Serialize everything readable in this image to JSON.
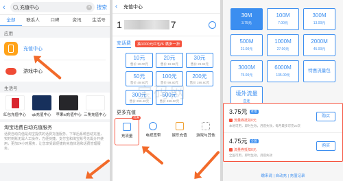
{
  "panel1": {
    "search_text": "充值中心",
    "clear_glyph": "×",
    "search_button": "搜索",
    "tabs": [
      {
        "label": "全部",
        "active": true
      },
      {
        "label": "联系人",
        "active": false
      },
      {
        "label": "口碑",
        "active": false
      },
      {
        "label": "资讯",
        "active": false
      },
      {
        "label": "生活号",
        "active": false
      }
    ],
    "apps_section": "应用",
    "apps": [
      {
        "name": "充值中心",
        "icon": "phone-icon"
      },
      {
        "name": "游戏中心",
        "icon": "gamepad-icon"
      }
    ],
    "life_section": "生活号",
    "life_items": [
      {
        "name": "红包充值中心"
      },
      {
        "name": "qb充值中心"
      },
      {
        "name": "苹果id充值中心"
      },
      {
        "name": "三角充值中心"
      }
    ],
    "article_title": "淘宝话费自动充值服务",
    "article_body": "话费自动充值是淘宝提供的话费充值服务，下单后系统自动充值，实时到账无需人工操作，方便快捷。支付宝和淘宝账号无需分开使用，更加24小时服务，让您享受最便捷的充值体验和话费管理服务。"
  },
  "panel2": {
    "title": "充值中心",
    "phone_prefix": "1",
    "phone_suffix": "7",
    "tab_label": "充话费",
    "promo": "抽1000元红包/6 满多一折",
    "amounts": [
      {
        "value": "10元",
        "sub": "售价 10.00元"
      },
      {
        "value": "20元",
        "sub": "售价 19.96元"
      },
      {
        "value": "30元",
        "sub": "售价 29.94元"
      },
      {
        "value": "50元",
        "sub": "售价 49.90元"
      },
      {
        "value": "100元",
        "sub": "售价 99.80元"
      },
      {
        "value": "200元",
        "sub": "售价 199.60元"
      },
      {
        "value": "300元",
        "sub": "售价 299.40元"
      },
      {
        "value": "500元",
        "sub": "售价 499.00元"
      }
    ],
    "more_title": "更多充值",
    "more_items": [
      {
        "name": "充流量",
        "icon": "flow-icon",
        "badge": "优惠"
      },
      {
        "name": "电视宽带",
        "icon": "tv-icon"
      },
      {
        "name": "娱乐充值",
        "icon": "video-icon"
      },
      {
        "name": "游戏与其他",
        "icon": "grid-icon"
      }
    ],
    "watermark": "宝码网"
  },
  "panel3": {
    "flows": [
      {
        "value": "30M",
        "sub": "3.75元",
        "selected": true
      },
      {
        "value": "100M",
        "sub": "7.00元"
      },
      {
        "value": "300M",
        "sub": "13.00元"
      },
      {
        "value": "500M",
        "sub": "21.00元"
      },
      {
        "value": "1000M",
        "sub": "27.00元"
      },
      {
        "value": "2000M",
        "sub": "45.00元"
      },
      {
        "value": "3000M",
        "sub": "75.00元"
      },
      {
        "value": "6000M",
        "sub": "135.00元"
      },
      {
        "value": "特惠流量包",
        "sub": ""
      },
      {
        "value": "境外流量",
        "sub": "直连"
      }
    ],
    "results": [
      {
        "price": "3.75元",
        "tag": "本地",
        "sub1": "流量券抵扣0元",
        "sub2": "本地可用，即时生效，月底失效，每月最多可充20次",
        "buy": "购买"
      },
      {
        "price": "4.75元",
        "tag": "全国",
        "sub1": "流量券抵扣0元",
        "sub2": "全国可用，即时生效，月底失效",
        "buy": "购买"
      }
    ],
    "footer": "缴来说 | 自动充 | 充值记录"
  },
  "colors": {
    "accent": "#3b8ef0",
    "highlight": "#f5523d",
    "arrow": "#f26a2a"
  }
}
